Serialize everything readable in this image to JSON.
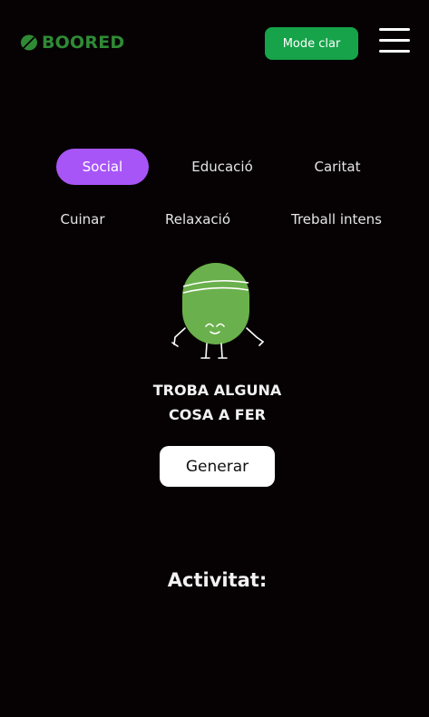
{
  "header": {
    "logo_text": "BOORED",
    "mode_button_label": "Mode clar",
    "menu_icon": "hamburger-menu-icon"
  },
  "categories": [
    {
      "label": "Social",
      "active": true
    },
    {
      "label": "Educació",
      "active": false
    },
    {
      "label": "Caritat",
      "active": false
    },
    {
      "label": "Cuinar",
      "active": false
    },
    {
      "label": "Relaxació",
      "active": false
    },
    {
      "label": "Treball intens",
      "active": false
    }
  ],
  "hero": {
    "mascot_icon": "bean-mascot-icon",
    "headline_line1": "TROBA ALGUNA",
    "headline_line2": "COSA A FER",
    "generate_label": "Generar"
  },
  "activity": {
    "title": "Activitat:"
  },
  "colors": {
    "background": "#060203",
    "brand_green": "#2f8a35",
    "mode_button": "#16a34a",
    "active_category": "#a855f7",
    "mascot_green": "#6ab04c"
  }
}
